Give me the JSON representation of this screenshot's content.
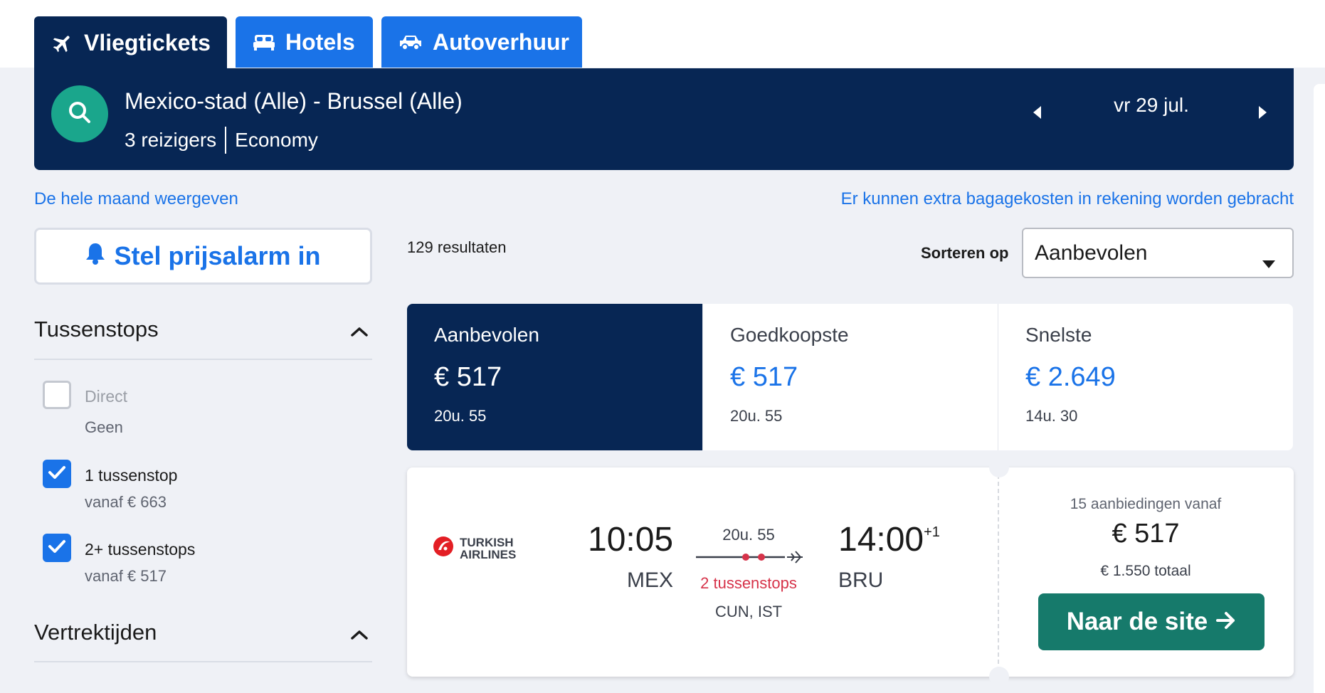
{
  "tabs": [
    {
      "label": "Vliegtickets",
      "active": true,
      "icon": "plane-icon"
    },
    {
      "label": "Hotels",
      "active": false,
      "icon": "bed-icon"
    },
    {
      "label": "Autoverhuur",
      "active": false,
      "icon": "car-icon"
    }
  ],
  "search": {
    "route": "Mexico-stad (Alle) - Brussel (Alle)",
    "travellers": "3 reizigers",
    "cabin": "Economy",
    "date": "vr 29 jul."
  },
  "links": {
    "month": "De hele maand weergeven",
    "baggage": "Er kunnen extra bagagekosten in rekening worden gebracht"
  },
  "alarm": {
    "label": "Stel prijsalarm in"
  },
  "filters": {
    "stops": {
      "title": "Tussenstops",
      "options": [
        {
          "label": "Direct",
          "sub": "Geen",
          "checked": false
        },
        {
          "label": "1 tussenstop",
          "sub": "vanaf € 663",
          "checked": true
        },
        {
          "label": "2+ tussenstops",
          "sub": "vanaf € 517",
          "checked": true
        }
      ]
    },
    "departure": {
      "title": "Vertrektijden"
    }
  },
  "results": {
    "count": "129 resultaten",
    "sort_label": "Sorteren op",
    "sort_value": "Aanbevolen"
  },
  "sort_tabs": [
    {
      "title": "Aanbevolen",
      "price": "€ 517",
      "duration": "20u. 55",
      "active": true
    },
    {
      "title": "Goedkoopste",
      "price": "€ 517",
      "duration": "20u. 55",
      "active": false
    },
    {
      "title": "Snelste",
      "price": "€ 2.649",
      "duration": "14u. 30",
      "active": false
    }
  ],
  "flight": {
    "airline": {
      "line1": "TURKISH",
      "line2": "AIRLINES"
    },
    "dep_time": "10:05",
    "dep_code": "MEX",
    "arr_time": "14:00",
    "arr_plus": "+1",
    "arr_code": "BRU",
    "duration": "20u. 55",
    "stops": "2 tussenstops",
    "stop_airports": "CUN, IST",
    "offers": "15 aanbiedingen vanaf",
    "price": "€ 517",
    "total": "€ 1.550 totaal",
    "cta": "Naar de site"
  },
  "colors": {
    "navy": "#072654",
    "blue": "#1a73e8",
    "teal": "#1aa68c",
    "cta_green": "#167a6b",
    "stop_red": "#d6334a",
    "turkish_red": "#e31e24"
  }
}
